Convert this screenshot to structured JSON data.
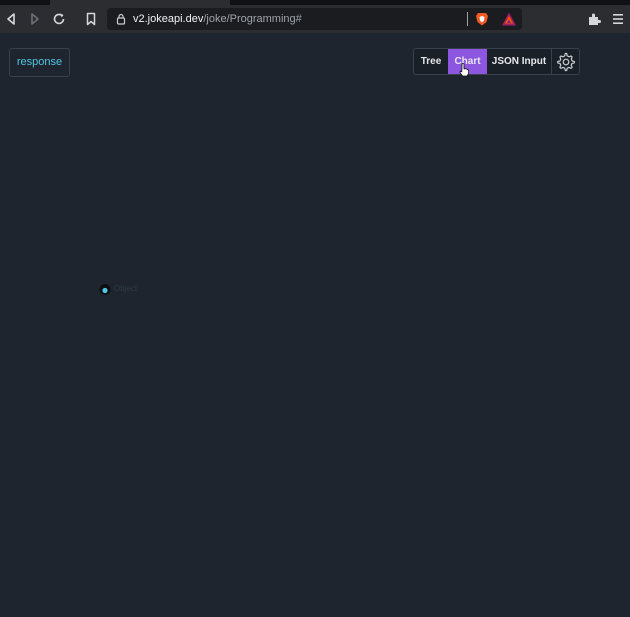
{
  "browser": {
    "url_host": "v2.jokeapi.dev",
    "url_path": "/joke/Programming#",
    "icons": [
      "back-icon",
      "forward-icon",
      "reload-icon",
      "bookmark-icon",
      "lock-icon",
      "brave-shields-icon",
      "brave-rewards-icon",
      "extensions-icon",
      "menu-icon"
    ]
  },
  "app": {
    "response_label": "response",
    "view_tabs": [
      {
        "label": "Tree",
        "active": false
      },
      {
        "label": "Chart",
        "active": true
      },
      {
        "label": "JSON Input",
        "active": false
      }
    ],
    "settings_icon": "gear-icon",
    "chart_node": {
      "label": "Object"
    }
  },
  "colors": {
    "background": "#1e252e",
    "accent": "#8c56e0",
    "response_text": "#4fc6e3"
  }
}
